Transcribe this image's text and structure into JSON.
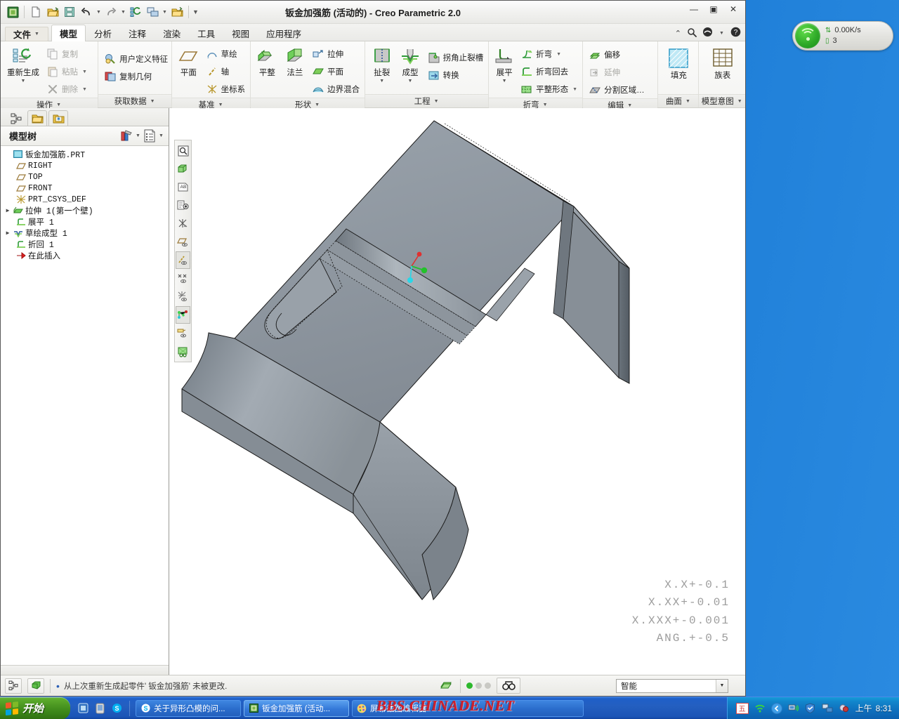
{
  "window": {
    "title": "钣金加强筋 (活动的) - Creo Parametric 2.0",
    "minimize": "—",
    "maximize": "▣",
    "close": "✕"
  },
  "quick_access": {
    "items": [
      {
        "name": "creo-logo-icon",
        "glyph": "▣"
      },
      {
        "name": "new-file-icon",
        "glyph": "🗋"
      },
      {
        "name": "open-file-icon",
        "glyph": "📂"
      },
      {
        "name": "save-icon",
        "glyph": "💾"
      },
      {
        "name": "undo-icon",
        "glyph": "↶"
      },
      {
        "name": "redo-icon",
        "glyph": "↷"
      },
      {
        "name": "regenerate-icon",
        "glyph": "⟳"
      },
      {
        "name": "window-switch-icon",
        "glyph": "❏"
      },
      {
        "name": "close-window-icon",
        "glyph": "📁"
      },
      {
        "name": "customize-qat-icon",
        "glyph": "▼"
      }
    ]
  },
  "tabs": {
    "file_label": "文件",
    "items": [
      {
        "label": "模型",
        "active": true
      },
      {
        "label": "分析",
        "active": false
      },
      {
        "label": "注释",
        "active": false
      },
      {
        "label": "渲染",
        "active": false
      },
      {
        "label": "工具",
        "active": false
      },
      {
        "label": "视图",
        "active": false
      },
      {
        "label": "应用程序",
        "active": false
      }
    ],
    "right_icons": [
      {
        "name": "collapse-ribbon-icon",
        "glyph": "⌃"
      },
      {
        "name": "search-icon",
        "glyph": "🔍"
      },
      {
        "name": "quick-link-icon",
        "glyph": "◒"
      },
      {
        "name": "quick-link-dropdown-icon",
        "glyph": "▼"
      },
      {
        "name": "help-icon",
        "glyph": "?"
      }
    ]
  },
  "ribbon": {
    "groups": [
      {
        "label": "操作",
        "big": [
          {
            "label": "重新生成",
            "icon": "regenerate-icon",
            "dropdown": true
          }
        ],
        "columns": [
          [
            {
              "label": "复制",
              "icon": "copy-icon",
              "disabled": true,
              "dropdown": false
            },
            {
              "label": "粘贴",
              "icon": "paste-icon",
              "disabled": true,
              "dropdown": true
            },
            {
              "label": "删除",
              "icon": "delete-icon",
              "disabled": true,
              "dropdown": true
            }
          ]
        ]
      },
      {
        "label": "获取数据",
        "big": [],
        "columns": [
          [
            {
              "label": "用户定义特征",
              "icon": "udf-icon",
              "disabled": false,
              "dropdown": false
            },
            {
              "label": "复制几何",
              "icon": "copy-geometry-icon",
              "disabled": false,
              "dropdown": false
            }
          ]
        ]
      },
      {
        "label": "基准",
        "big": [
          {
            "label": "平面",
            "icon": "datum-plane-icon",
            "dropdown": false
          }
        ],
        "columns": [
          [
            {
              "label": "草绘",
              "icon": "sketch-icon",
              "disabled": false,
              "dropdown": false
            },
            {
              "label": "轴",
              "icon": "datum-axis-icon",
              "disabled": false,
              "dropdown": false
            },
            {
              "label": "坐标系",
              "icon": "coordinate-system-icon",
              "disabled": false,
              "dropdown": false
            }
          ]
        ]
      },
      {
        "label": "形状",
        "big": [
          {
            "label": "平整",
            "icon": "flat-wall-icon",
            "dropdown": false
          },
          {
            "label": "法兰",
            "icon": "flange-wall-icon",
            "dropdown": false
          }
        ],
        "columns": [
          [
            {
              "label": "拉伸",
              "icon": "extrude-icon",
              "disabled": false,
              "dropdown": false
            },
            {
              "label": "平面",
              "icon": "fill-plane-icon",
              "disabled": false,
              "dropdown": false
            },
            {
              "label": "边界混合",
              "icon": "boundary-blend-icon",
              "disabled": false,
              "dropdown": false
            }
          ]
        ]
      },
      {
        "label": "工程",
        "big": [
          {
            "label": "扯裂",
            "icon": "rip-icon",
            "dropdown": true
          },
          {
            "label": "成型",
            "icon": "form-icon",
            "dropdown": true
          }
        ],
        "columns": [
          [
            {
              "label": "拐角止裂槽",
              "icon": "corner-relief-icon",
              "disabled": false,
              "dropdown": false
            },
            {
              "label": "转换",
              "icon": "conversion-icon",
              "disabled": false,
              "dropdown": false
            }
          ]
        ]
      },
      {
        "label": "折弯",
        "big": [
          {
            "label": "展平",
            "icon": "unbend-icon",
            "dropdown": true
          }
        ],
        "columns": [
          [
            {
              "label": "折弯",
              "icon": "bend-icon",
              "disabled": false,
              "dropdown": true
            },
            {
              "label": "折弯回去",
              "icon": "bend-back-icon",
              "disabled": false,
              "dropdown": false
            },
            {
              "label": "平整形态",
              "icon": "flat-state-icon",
              "disabled": false,
              "dropdown": true
            }
          ]
        ]
      },
      {
        "label": "编辑",
        "big": [],
        "columns": [
          [
            {
              "label": "偏移",
              "icon": "offset-icon",
              "disabled": false,
              "dropdown": false
            },
            {
              "label": "延伸",
              "icon": "extend-icon",
              "disabled": true,
              "dropdown": false
            },
            {
              "label": "分割区域…",
              "icon": "split-area-icon",
              "disabled": false,
              "dropdown": false
            }
          ]
        ]
      },
      {
        "label": "曲面",
        "big": [
          {
            "label": "填充",
            "icon": "fill-surface-icon",
            "dropdown": false
          }
        ],
        "columns": []
      },
      {
        "label": "模型意图",
        "big": [
          {
            "label": "族表",
            "icon": "family-table-icon",
            "dropdown": false
          }
        ],
        "columns": []
      }
    ]
  },
  "navigator": {
    "tabs": [
      {
        "name": "model-tree-tab",
        "glyph": "⊞"
      },
      {
        "name": "folder-browser-tab",
        "glyph": "📁"
      },
      {
        "name": "favorites-tab",
        "glyph": "✷"
      }
    ],
    "title": "模型树",
    "header_icons": [
      {
        "name": "tree-filters-icon",
        "glyph": "🛠"
      },
      {
        "name": "tree-filters-dropdown-icon",
        "glyph": "▼"
      },
      {
        "name": "tree-settings-icon",
        "glyph": "▤"
      },
      {
        "name": "tree-settings-dropdown-icon",
        "glyph": "▼"
      }
    ],
    "tree": [
      {
        "label": "钣金加强筋.PRT",
        "icon": "part-icon",
        "indent": 0,
        "expander": "-"
      },
      {
        "label": "RIGHT",
        "icon": "datum-plane-icon",
        "indent": 1,
        "expander": ""
      },
      {
        "label": "TOP",
        "icon": "datum-plane-icon",
        "indent": 1,
        "expander": ""
      },
      {
        "label": "FRONT",
        "icon": "datum-plane-icon",
        "indent": 1,
        "expander": ""
      },
      {
        "label": "PRT_CSYS_DEF",
        "icon": "coordinate-system-icon",
        "indent": 1,
        "expander": ""
      },
      {
        "label": "拉伸 1(第一个壁)",
        "icon": "extrude-feature-icon",
        "indent": 1,
        "expander": "▶"
      },
      {
        "label": "展平 1",
        "icon": "unbend-feature-icon",
        "indent": 1,
        "expander": ""
      },
      {
        "label": "草绘成型 1",
        "icon": "form-feature-icon",
        "indent": 1,
        "expander": "▶"
      },
      {
        "label": "折回 1",
        "icon": "bend-back-feature-icon",
        "indent": 1,
        "expander": ""
      },
      {
        "label": "在此插入",
        "icon": "insert-here-icon",
        "indent": 1,
        "expander": ""
      }
    ]
  },
  "viewport": {
    "toolbar": [
      {
        "name": "repaint-icon",
        "glyph": "🔍",
        "active": false
      },
      {
        "name": "display-style-icon",
        "glyph": "▱",
        "active": false
      },
      {
        "name": "annotation-display-icon",
        "glyph": "AB",
        "active": false
      },
      {
        "name": "saved-view-icon",
        "glyph": "▣",
        "active": false
      },
      {
        "name": "datum-display-off-icon",
        "glyph": "✳",
        "active": false
      },
      {
        "name": "plane-display-icon",
        "glyph": "▱",
        "active": false
      },
      {
        "name": "axis-display-icon",
        "glyph": "╱",
        "active": true
      },
      {
        "name": "point-display-icon",
        "glyph": "✕",
        "active": false
      },
      {
        "name": "csys-display-icon",
        "glyph": "✳",
        "active": false
      },
      {
        "name": "annotation-elements-icon",
        "glyph": "⚬",
        "active": true
      },
      {
        "name": "layer-display-icon",
        "glyph": "▭",
        "active": false
      },
      {
        "name": "spin-center-icon",
        "glyph": "◉",
        "active": false
      }
    ],
    "tolerance_lines": [
      "X.X+-0.1",
      "X.XX+-0.01",
      "X.XXX+-0.001",
      "ANG.+-0.5"
    ],
    "triad": {
      "x_color": "#e03030",
      "y_color": "#22c22a",
      "z_color": "#28d8e8"
    },
    "model_color": "#8a929b"
  },
  "status_bar": {
    "left_icons": [
      {
        "name": "model-tree-toggle-icon",
        "glyph": "⊞"
      },
      {
        "name": "shaded-display-icon",
        "glyph": "◈"
      }
    ],
    "message": "从上次重新生成起零件' 钣金加强筋' 未被更改.",
    "right_icons": [
      {
        "name": "regeneration-status-icon",
        "glyph": "◈"
      },
      {
        "name": "selection-filter-icon",
        "glyph": "🔍"
      }
    ],
    "leds": [
      true,
      false,
      false
    ],
    "filter_value": "智能",
    "filter_dropdown_glyph": "▼"
  },
  "taskbar": {
    "start_label": "开始",
    "quick_launch": [
      {
        "name": "show-desktop-icon",
        "glyph": "▤"
      },
      {
        "name": "media-player-icon",
        "glyph": "▯"
      },
      {
        "name": "skype-icon",
        "glyph": "S"
      }
    ],
    "tasks": [
      {
        "label": "关于异形凸模的问...",
        "icon": "skype-icon",
        "active": false
      },
      {
        "label": "钣金加强筋 (活动...",
        "icon": "creo-icon",
        "active": true
      },
      {
        "label": "屏幕截图编辑器",
        "icon": "paint-icon",
        "active": false
      }
    ],
    "tray": [
      {
        "name": "ime-indicator-icon",
        "glyph": "五"
      },
      {
        "name": "wifi-icon",
        "glyph": "◗"
      },
      {
        "name": "show-hidden-icons-icon",
        "glyph": "‹"
      },
      {
        "name": "network-monitor-icon",
        "glyph": "▤"
      },
      {
        "name": "security-shield-icon",
        "glyph": "⛉"
      },
      {
        "name": "network-connection-icon",
        "glyph": "▦"
      },
      {
        "name": "sound-icon",
        "glyph": "◕"
      }
    ],
    "clock_period": "上午",
    "clock_time": "8:31"
  },
  "net_widget": {
    "speed": "0.00K/s",
    "count": "3",
    "speed_icon": "upload-download-icon",
    "count_icon": "device-icon"
  },
  "watermark": "BBS.CHINADE.NET"
}
